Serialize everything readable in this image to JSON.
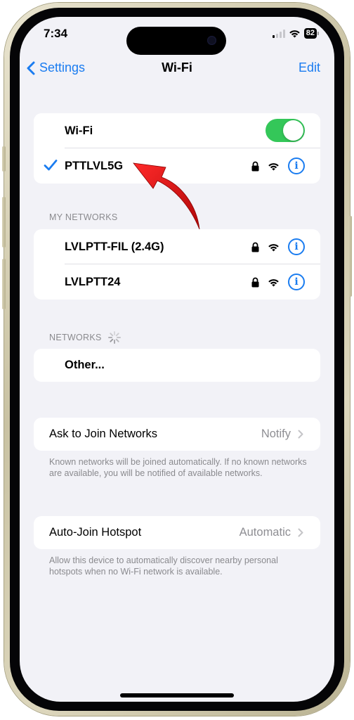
{
  "status_bar": {
    "time": "7:34",
    "battery_level": "82",
    "signal_bars_active": 1,
    "signal_bars_total": 4
  },
  "nav": {
    "back_label": "Settings",
    "title": "Wi-Fi",
    "edit_label": "Edit"
  },
  "wifi": {
    "toggle_label": "Wi-Fi",
    "enabled": true,
    "connected_network": "PTTLVL5G"
  },
  "my_networks": {
    "header": "MY NETWORKS",
    "items": [
      {
        "name": "LVLPTT-FIL (2.4G)",
        "secured": true
      },
      {
        "name": "LVLPTT24",
        "secured": true
      }
    ]
  },
  "networks": {
    "header": "NETWORKS",
    "other_label": "Other..."
  },
  "ask_to_join": {
    "label": "Ask to Join Networks",
    "value": "Notify",
    "footnote": "Known networks will be joined automatically. If no known networks are available, you will be notified of available networks."
  },
  "auto_join_hotspot": {
    "label": "Auto-Join Hotspot",
    "value": "Automatic",
    "footnote": "Allow this device to automatically discover nearby personal hotspots when no Wi-Fi network is available."
  },
  "colors": {
    "accent": "#1a7cf0",
    "toggle_on": "#34c759",
    "background": "#f2f2f7",
    "annotation_arrow": "#e01010"
  },
  "icons": {
    "back": "chevron-left-icon",
    "check": "checkmark-icon",
    "lock": "lock-icon",
    "wifi": "wifi-icon",
    "info": "info-icon",
    "chevron": "chevron-right-icon",
    "spinner": "loading-spinner-icon"
  }
}
